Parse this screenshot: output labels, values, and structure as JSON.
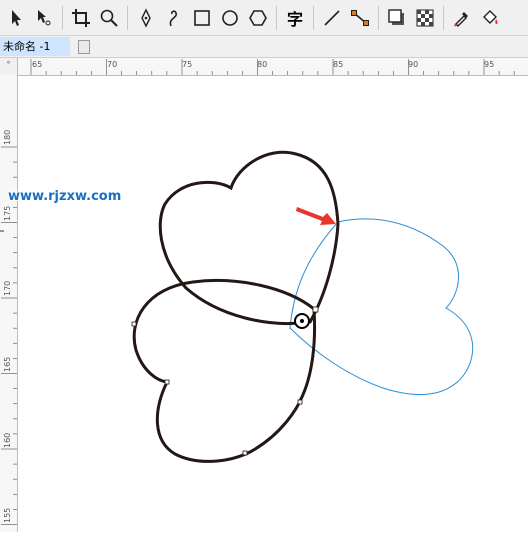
{
  "document": {
    "tab_title": "未命名 -1"
  },
  "toolbar": {
    "tools": [
      "pick-tool",
      "shape-tool",
      "crop-tool",
      "zoom-tool",
      "pen-tool",
      "artistic-media-tool",
      "rectangle-tool",
      "ellipse-tool",
      "polygon-tool",
      "text-tool",
      "connector-tool",
      "blend-tool",
      "drop-shadow-tool",
      "transparency-tool",
      "eyedropper-tool",
      "fill-tool"
    ],
    "text_tool_glyph": "字"
  },
  "rulers": {
    "corner_label": "°",
    "horizontal": [
      "65",
      "70",
      "75",
      "80",
      "85",
      "90",
      "95"
    ],
    "vertical": [
      "180",
      "175",
      "170",
      "165",
      "160",
      "155"
    ]
  },
  "watermark": "www.rjzxw.com",
  "colors": {
    "selection_accent": "#1f7bd0",
    "shape_stroke": "#231815",
    "guide_stroke": "#2a8fd6",
    "arrow": "#e8362d"
  }
}
